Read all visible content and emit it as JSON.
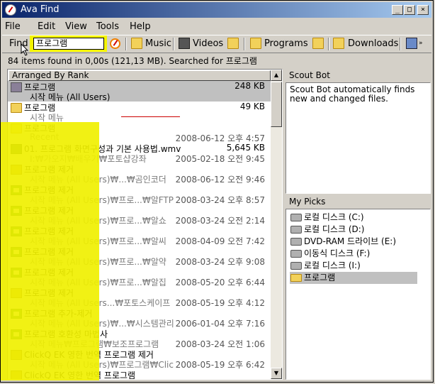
{
  "window": {
    "title": "Ava Find"
  },
  "menu": [
    "File",
    "Edit",
    "View",
    "Tools",
    "Help"
  ],
  "toolbar": {
    "find_label": "Find",
    "find_value": "프로그램",
    "buttons": [
      {
        "label": "Music",
        "icon": "music-folder-icon"
      },
      {
        "label": "Videos",
        "icon": "film-icon"
      },
      {
        "label": "Programs",
        "icon": "programs-folder-icon"
      },
      {
        "label": "Downloads",
        "icon": "downloads-icon"
      }
    ]
  },
  "status_text": "84 items found in 0,00s (121,13 MB).  Searched for 프로그램",
  "list": {
    "header": "Arranged By Rank",
    "rows": [
      {
        "name": "프로그램",
        "path": "시작 메뉴 (All Users)",
        "size": "248 KB",
        "date": "",
        "icon": "folder-gray"
      },
      {
        "name": "프로그램",
        "path": "시작 메뉴",
        "size": "49 KB",
        "date": "",
        "icon": "folder"
      },
      {
        "name": "프로그램",
        "path": "Recent",
        "size": "",
        "date": "2008-06-12 오후 4:57",
        "icon": "folder"
      },
      {
        "name": "01. 프로그램 화면구성과 기본 사용법.wmv",
        "path": "I:₩가오지₩배우기₩포토샵강좌",
        "size": "5,645 KB",
        "date": "2005-02-18 오전 9:45",
        "icon": "wmv"
      },
      {
        "name": "프로그램 제거",
        "path": "시작 메뉴 (All Users)₩...₩곰인코더",
        "size": "",
        "date": "2008-06-12 오전 9:46",
        "icon": "box"
      },
      {
        "name": "프로그램 제거",
        "path": "시작 메뉴 (All Users)₩프로...₩알FTP",
        "size": "",
        "date": "2008-03-24 오후 8:57",
        "icon": "prog"
      },
      {
        "name": "프로그램 제거",
        "path": "시작 메뉴 (All Users)₩프로...₩알쇼",
        "size": "",
        "date": "2008-03-24 오전 2:14",
        "icon": "prog"
      },
      {
        "name": "프로그램 제거",
        "path": "시작 메뉴 (All Users)₩프로...₩알씨",
        "size": "",
        "date": "2008-04-09 오전 7:42",
        "icon": "prog"
      },
      {
        "name": "프로그램 제거",
        "path": "시작 메뉴 (All Users)₩프로...₩알약",
        "size": "",
        "date": "2008-03-24 오후 9:08",
        "icon": "prog"
      },
      {
        "name": "프로그램 제거",
        "path": "시작 메뉴 (All Users)₩프로...₩알집",
        "size": "",
        "date": "2008-05-20 오후 6:44",
        "icon": "prog"
      },
      {
        "name": "프로그램 제거",
        "path": "시작 메뉴 (All Users...₩포토스케이프",
        "size": "",
        "date": "2008-05-19 오후 4:12",
        "icon": "box"
      },
      {
        "name": "프로그램 추가-제거",
        "path": "시작 메뉴 (All Users)₩...₩시스템관리",
        "size": "",
        "date": "2006-01-04 오후 7:16",
        "icon": "prog"
      },
      {
        "name": "프로그램 호환성 마법사",
        "path": "시작 메뉴₩프로그램₩보조프로그램",
        "size": "",
        "date": "2008-03-24 오전 1:06",
        "icon": "prog"
      },
      {
        "name": "ClickQ EK 영한 번역 프로그램 제거",
        "path": "시작 메뉴 (All Users)₩프로그램₩Clic",
        "size": "",
        "date": "2008-05-19 오후 6:42",
        "icon": "box"
      },
      {
        "name": "ClickQ EK 영한 번역 프로그램",
        "path": "",
        "size": "",
        "date": "",
        "icon": "box"
      }
    ]
  },
  "scout_bot": {
    "title": "Scout Bot",
    "text": "Scout Bot automatically finds new and changed files."
  },
  "my_picks": {
    "title": "My Picks",
    "items": [
      {
        "label": "로컬 디스크 (C:)",
        "icon": "drive-icon"
      },
      {
        "label": "로컬 디스크 (D:)",
        "icon": "drive-icon"
      },
      {
        "label": "DVD-RAM 드라이브 (E:)",
        "icon": "dvd-drive-icon"
      },
      {
        "label": "이동식 디스크 (F:)",
        "icon": "removable-drive-icon"
      },
      {
        "label": "로컬 디스크 (I:)",
        "icon": "drive-icon"
      },
      {
        "label": "프로그램",
        "icon": "folder-icon"
      }
    ]
  },
  "colors": {
    "highlight": "#f4f400",
    "titlebar_start": "#0a246a",
    "titlebar_end": "#a6caf0",
    "selection": "#c0c0c0"
  }
}
